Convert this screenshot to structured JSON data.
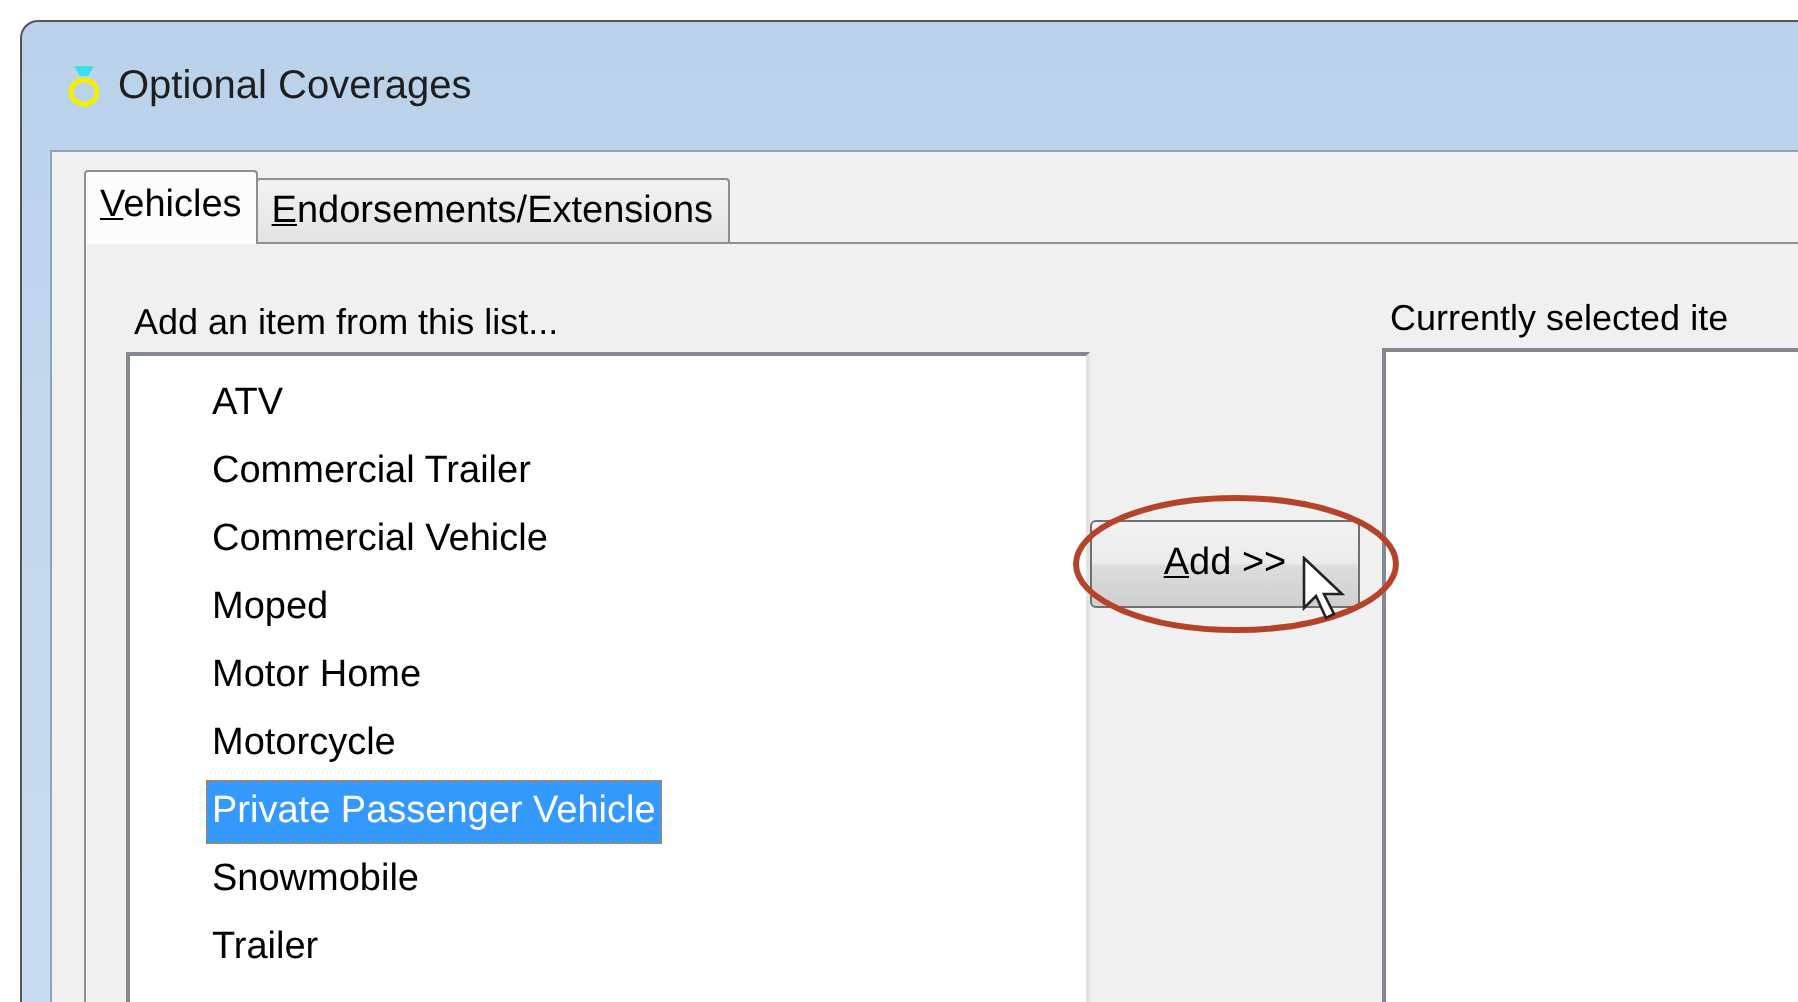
{
  "window": {
    "title": "Optional Coverages"
  },
  "tabs": [
    {
      "label": "Vehicles",
      "selected": true
    },
    {
      "label": "Endorsements/Extensions",
      "selected": false
    }
  ],
  "available_list": {
    "label": "Add an item from this list...",
    "items": [
      {
        "label": "ATV",
        "selected": false
      },
      {
        "label": "Commercial Trailer",
        "selected": false
      },
      {
        "label": "Commercial Vehicle",
        "selected": false
      },
      {
        "label": "Moped",
        "selected": false
      },
      {
        "label": "Motor Home",
        "selected": false
      },
      {
        "label": "Motorcycle",
        "selected": false
      },
      {
        "label": "Private Passenger Vehicle",
        "selected": true
      },
      {
        "label": "Snowmobile",
        "selected": false
      },
      {
        "label": "Trailer",
        "selected": false
      }
    ]
  },
  "add_button": {
    "label": "Add >>"
  },
  "selected_list": {
    "label": "Currently selected ite"
  }
}
